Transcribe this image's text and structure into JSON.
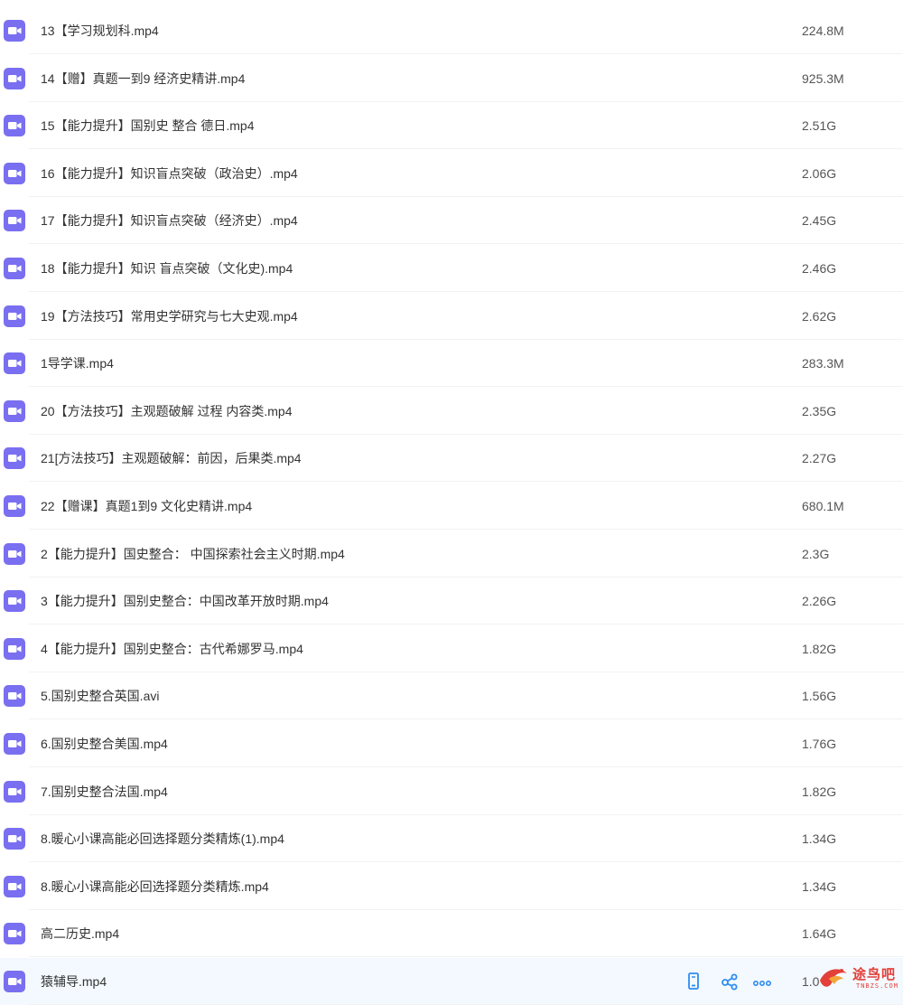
{
  "files": [
    {
      "name": "13【学习规划科.mp4",
      "size": "224.8M"
    },
    {
      "name": "14【赠】真题一到9 经济史精讲.mp4",
      "size": "925.3M"
    },
    {
      "name": "15【能力提升】国别史 整合 德日.mp4",
      "size": "2.51G"
    },
    {
      "name": "16【能力提升】知识盲点突破（政治史）.mp4",
      "size": "2.06G"
    },
    {
      "name": "17【能力提升】知识盲点突破（经济史）.mp4",
      "size": "2.45G"
    },
    {
      "name": "18【能力提升】知识 盲点突破（文化史).mp4",
      "size": "2.46G"
    },
    {
      "name": "19【方法技巧】常用史学研究与七大史观.mp4",
      "size": "2.62G"
    },
    {
      "name": "1导学课.mp4",
      "size": "283.3M"
    },
    {
      "name": "20【方法技巧】主观题破解 过程 内容类.mp4",
      "size": "2.35G"
    },
    {
      "name": "21[方法技巧】主观题破解：前因，后果类.mp4",
      "size": "2.27G"
    },
    {
      "name": "22【赠课】真题1到9 文化史精讲.mp4",
      "size": "680.1M"
    },
    {
      "name": "2【能力提升】国史整合： 中国探索社会主义时期.mp4",
      "size": "2.3G"
    },
    {
      "name": "3【能力提升】国别史整合：中国改革开放时期.mp4",
      "size": "2.26G"
    },
    {
      "name": "4【能力提升】国别史整合：古代希娜罗马.mp4",
      "size": "1.82G"
    },
    {
      "name": "5.国别史整合英国.avi",
      "size": "1.56G"
    },
    {
      "name": "6.国别史整合美国.mp4",
      "size": "1.76G"
    },
    {
      "name": "7.国别史整合法国.mp4",
      "size": "1.82G"
    },
    {
      "name": "8.暖心小课高能必回选择题分类精炼(1).mp4",
      "size": "1.34G"
    },
    {
      "name": "8.暖心小课高能必回选择题分类精炼.mp4",
      "size": "1.34G"
    },
    {
      "name": "高二历史.mp4",
      "size": "1.64G"
    },
    {
      "name": "猿辅导.mp4",
      "size": "1.0"
    }
  ],
  "row_actions": [
    "mobile-icon",
    "share-icon",
    "more-icon"
  ],
  "colors": {
    "video_icon": "#7a6ff0",
    "action_icon": "#2f8cf0",
    "active_row": "#f3f9fe",
    "watermark": "#e3403a"
  },
  "watermark": {
    "text": "途鸟吧",
    "sub": "TNBZS.COM"
  }
}
